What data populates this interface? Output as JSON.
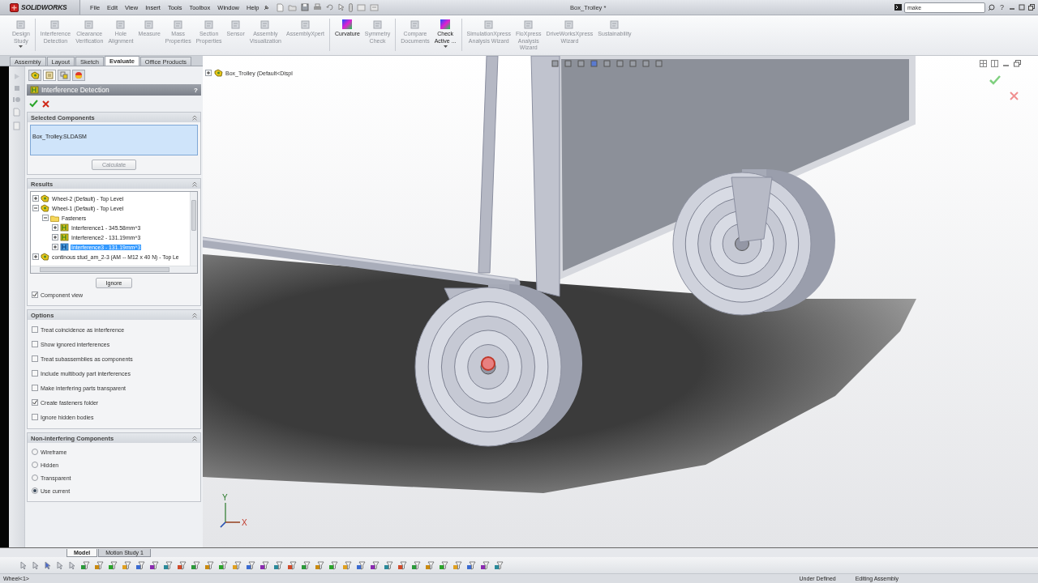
{
  "title_bar": {
    "logo": "SOLIDWORKS",
    "menu": [
      "File",
      "Edit",
      "View",
      "Insert",
      "Tools",
      "Toolbox",
      "Window",
      "Help"
    ],
    "document_title": "Box_Trolley *",
    "search": {
      "value": "make"
    },
    "help": "?"
  },
  "command_manager": {
    "buttons": [
      {
        "label": "Design\nStudy",
        "disabled": true,
        "has_menu": true,
        "separator_before": false
      },
      {
        "label": "Interference\nDetection",
        "disabled": true,
        "has_menu": false,
        "separator_before": true
      },
      {
        "label": "Clearance\nVerification",
        "disabled": true,
        "has_menu": false,
        "separator_before": false
      },
      {
        "label": "Hole\nAlignment",
        "disabled": true,
        "has_menu": false,
        "separator_before": false
      },
      {
        "label": "Measure",
        "disabled": true,
        "has_menu": false,
        "separator_before": false
      },
      {
        "label": "Mass\nProperties",
        "disabled": true,
        "has_menu": false,
        "separator_before": false
      },
      {
        "label": "Section\nProperties",
        "disabled": true,
        "has_menu": false,
        "separator_before": false
      },
      {
        "label": "Sensor",
        "disabled": true,
        "has_menu": false,
        "separator_before": false
      },
      {
        "label": "Assembly\nVisualization",
        "disabled": true,
        "has_menu": false,
        "separator_before": false
      },
      {
        "label": "AssemblyXpert",
        "disabled": true,
        "has_menu": false,
        "separator_before": false
      },
      {
        "label": "Curvature",
        "disabled": false,
        "has_menu": false,
        "separator_before": true
      },
      {
        "label": "Symmetry\nCheck",
        "disabled": true,
        "has_menu": false,
        "separator_before": false
      },
      {
        "label": "Compare\nDocuments",
        "disabled": true,
        "has_menu": false,
        "separator_before": true
      },
      {
        "label": "Check\nActive ...",
        "disabled": false,
        "has_menu": true,
        "separator_before": false
      },
      {
        "label": "SimulationXpress\nAnalysis Wizard",
        "disabled": true,
        "has_menu": false,
        "separator_before": true
      },
      {
        "label": "FloXpress\nAnalysis\nWizard",
        "disabled": true,
        "has_menu": false,
        "separator_before": false
      },
      {
        "label": "DriveWorksXpress\nWizard",
        "disabled": true,
        "has_menu": false,
        "separator_before": false
      },
      {
        "label": "Sustainability",
        "disabled": true,
        "has_menu": false,
        "separator_before": false
      }
    ],
    "tabs": [
      {
        "label": "Assembly",
        "selected": false
      },
      {
        "label": "Layout",
        "selected": false
      },
      {
        "label": "Sketch",
        "selected": false
      },
      {
        "label": "Evaluate",
        "selected": true
      },
      {
        "label": "Office Products",
        "selected": false
      }
    ]
  },
  "property_manager": {
    "panel_tabs": [
      {
        "selected": false
      },
      {
        "selected": true
      },
      {
        "selected": false
      },
      {
        "selected": false
      }
    ],
    "title": "Interference Detection",
    "help": "?",
    "selected_components": {
      "heading": "Selected Components",
      "items": [
        "Box_Trolley.SLDASM"
      ],
      "button": "Calculate"
    },
    "results": {
      "heading": "Results",
      "tree": [
        {
          "label": "Wheel-2 (Default) - Top Level",
          "kind": "component",
          "expanded": false,
          "selected": false
        },
        {
          "label": "Wheel-1 (Default) - Top Level",
          "kind": "component",
          "expanded": true,
          "selected": false,
          "children": [
            {
              "label": "Fasteners",
              "kind": "folder",
              "expanded": true,
              "selected": false,
              "children": [
                {
                  "label": "Interference1 - 345.58mm^3",
                  "kind": "interference",
                  "expanded": false,
                  "selected": false
                },
                {
                  "label": "Interference2 - 131.19mm^3",
                  "kind": "interference",
                  "expanded": false,
                  "selected": false
                },
                {
                  "label": "Interference3 - 131.19mm^3",
                  "kind": "interference",
                  "expanded": false,
                  "selected": true
                }
              ]
            }
          ]
        },
        {
          "label": "continous stud_am_2-3 (AM -- M12 x 40  N) - Top Le",
          "kind": "component",
          "expanded": false,
          "selected": false
        }
      ],
      "button": "Ignore",
      "component_view": {
        "label": "Component view",
        "checked": true
      }
    },
    "options": {
      "heading": "Options",
      "items": [
        {
          "label": "Treat coincidence as interference",
          "checked": false
        },
        {
          "label": "Show ignored interferences",
          "checked": false
        },
        {
          "label": "Treat subassemblies as components",
          "checked": false
        },
        {
          "label": "Include multibody part interferences",
          "checked": false
        },
        {
          "label": "Make interfering parts transparent",
          "checked": false
        },
        {
          "label": "Create fasteners folder",
          "checked": true
        },
        {
          "label": "Ignore hidden bodies",
          "checked": false
        }
      ]
    },
    "non_interfering": {
      "heading": "Non-interfering Components",
      "items": [
        {
          "label": "Wireframe",
          "selected": false
        },
        {
          "label": "Hidden",
          "selected": false
        },
        {
          "label": "Transparent",
          "selected": false
        },
        {
          "label": "Use current",
          "selected": true
        }
      ]
    }
  },
  "viewport": {
    "tree_root": "Box_Trolley  (Default<Displ",
    "triad": {
      "x_label": "X",
      "y_label": "Y"
    }
  },
  "bottom_tabs": [
    {
      "label": "Model",
      "selected": true
    },
    {
      "label": "Motion Study 1",
      "selected": false
    }
  ],
  "status_bar": {
    "selection": "Wheel<1>",
    "fields": [
      "Under Defined",
      "Editing Assembly"
    ]
  }
}
